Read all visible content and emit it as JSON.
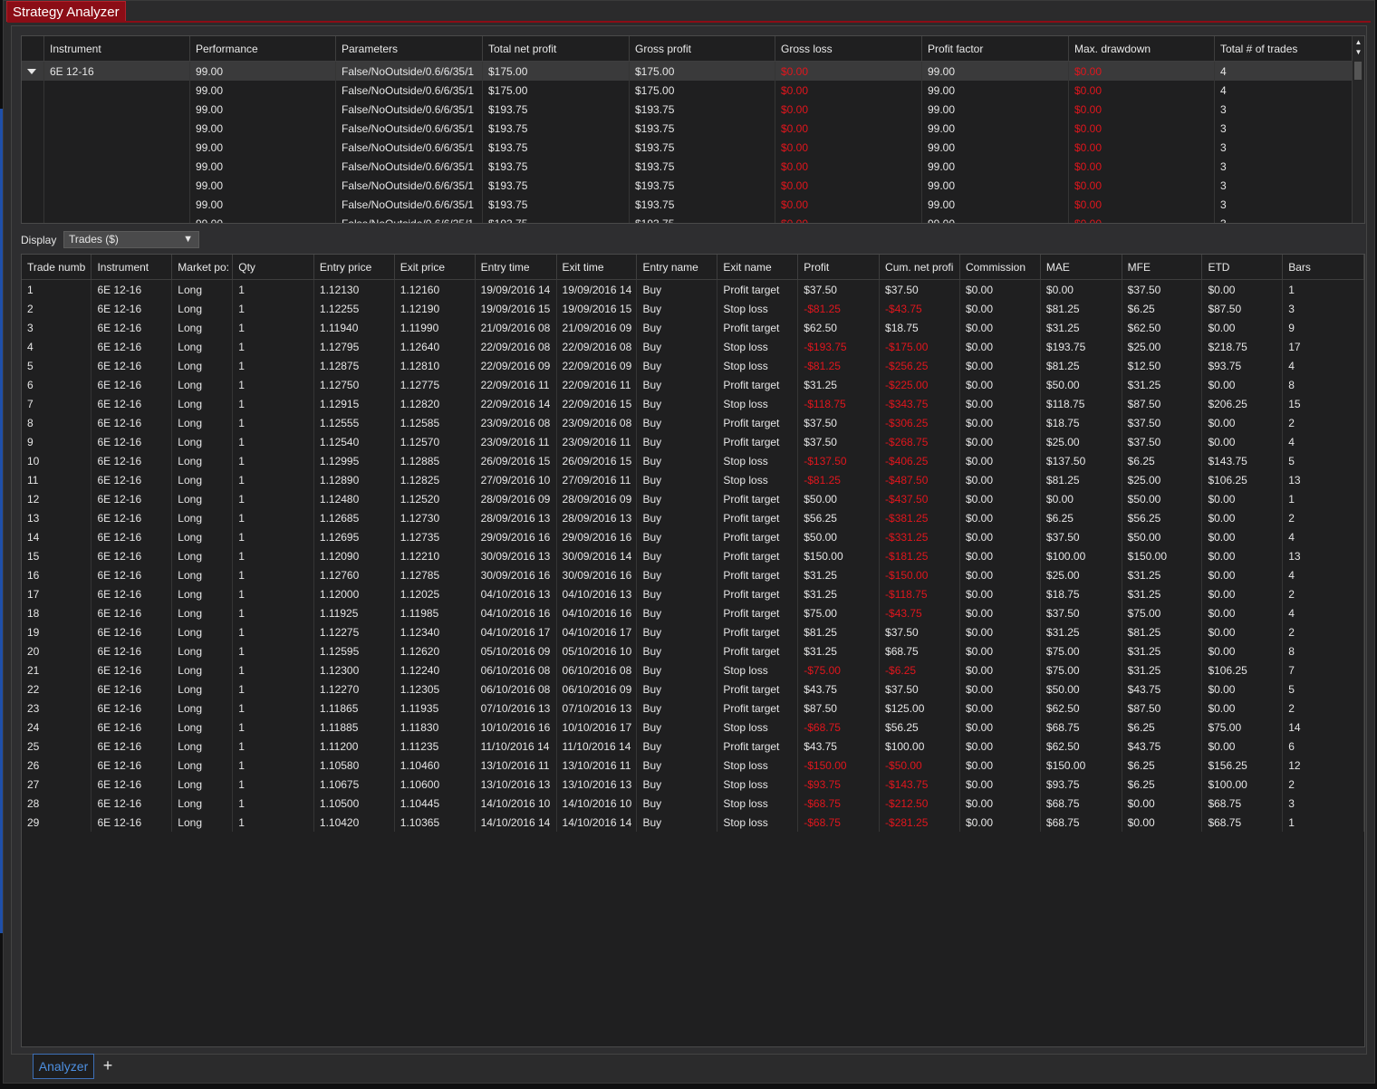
{
  "window": {
    "title": "Strategy Analyzer"
  },
  "optimizer": {
    "columns": [
      "Instrument",
      "Performance",
      "Parameters",
      "Total net profit",
      "Gross profit",
      "Gross loss",
      "Profit factor",
      "Max. drawdown",
      "Total # of trades"
    ],
    "group_instrument": "6E 12-16",
    "rows": [
      [
        "99.00",
        "False/NoOutside/0.6/6/35/1",
        "$175.00",
        "$175.00",
        "$0.00",
        "99.00",
        "$0.00",
        "4"
      ],
      [
        "99.00",
        "False/NoOutside/0.6/6/35/1",
        "$175.00",
        "$175.00",
        "$0.00",
        "99.00",
        "$0.00",
        "4"
      ],
      [
        "99.00",
        "False/NoOutside/0.6/6/35/1",
        "$193.75",
        "$193.75",
        "$0.00",
        "99.00",
        "$0.00",
        "3"
      ],
      [
        "99.00",
        "False/NoOutside/0.6/6/35/1",
        "$193.75",
        "$193.75",
        "$0.00",
        "99.00",
        "$0.00",
        "3"
      ],
      [
        "99.00",
        "False/NoOutside/0.6/6/35/1",
        "$193.75",
        "$193.75",
        "$0.00",
        "99.00",
        "$0.00",
        "3"
      ],
      [
        "99.00",
        "False/NoOutside/0.6/6/35/1",
        "$193.75",
        "$193.75",
        "$0.00",
        "99.00",
        "$0.00",
        "3"
      ],
      [
        "99.00",
        "False/NoOutside/0.6/6/35/1",
        "$193.75",
        "$193.75",
        "$0.00",
        "99.00",
        "$0.00",
        "3"
      ],
      [
        "99.00",
        "False/NoOutside/0.6/6/35/1",
        "$193.75",
        "$193.75",
        "$0.00",
        "99.00",
        "$0.00",
        "3"
      ],
      [
        "99.00",
        "False/NoOutside/0.6/6/35/1",
        "$193.75",
        "$193.75",
        "$0.00",
        "99.00",
        "$0.00",
        "3"
      ]
    ]
  },
  "display": {
    "label": "Display",
    "selected": "Trades ($)"
  },
  "trades": {
    "columns": [
      "Trade numb",
      "Instrument",
      "Market po:",
      "Qty",
      "Entry price",
      "Exit price",
      "Entry time",
      "Exit time",
      "Entry name",
      "Exit name",
      "Profit",
      "Cum. net profi",
      "Commission",
      "MAE",
      "MFE",
      "ETD",
      "Bars"
    ],
    "rows": [
      [
        "1",
        "6E 12-16",
        "Long",
        "1",
        "1.12130",
        "1.12160",
        "19/09/2016 14",
        "19/09/2016 14",
        "Buy",
        "Profit target",
        "$37.50",
        "$37.50",
        "$0.00",
        "$0.00",
        "$37.50",
        "$0.00",
        "1"
      ],
      [
        "2",
        "6E 12-16",
        "Long",
        "1",
        "1.12255",
        "1.12190",
        "19/09/2016 15",
        "19/09/2016 15",
        "Buy",
        "Stop loss",
        "-$81.25",
        "-$43.75",
        "$0.00",
        "$81.25",
        "$6.25",
        "$87.50",
        "3"
      ],
      [
        "3",
        "6E 12-16",
        "Long",
        "1",
        "1.11940",
        "1.11990",
        "21/09/2016 08",
        "21/09/2016 09",
        "Buy",
        "Profit target",
        "$62.50",
        "$18.75",
        "$0.00",
        "$31.25",
        "$62.50",
        "$0.00",
        "9"
      ],
      [
        "4",
        "6E 12-16",
        "Long",
        "1",
        "1.12795",
        "1.12640",
        "22/09/2016 08",
        "22/09/2016 08",
        "Buy",
        "Stop loss",
        "-$193.75",
        "-$175.00",
        "$0.00",
        "$193.75",
        "$25.00",
        "$218.75",
        "17"
      ],
      [
        "5",
        "6E 12-16",
        "Long",
        "1",
        "1.12875",
        "1.12810",
        "22/09/2016 09",
        "22/09/2016 09",
        "Buy",
        "Stop loss",
        "-$81.25",
        "-$256.25",
        "$0.00",
        "$81.25",
        "$12.50",
        "$93.75",
        "4"
      ],
      [
        "6",
        "6E 12-16",
        "Long",
        "1",
        "1.12750",
        "1.12775",
        "22/09/2016 11",
        "22/09/2016 11",
        "Buy",
        "Profit target",
        "$31.25",
        "-$225.00",
        "$0.00",
        "$50.00",
        "$31.25",
        "$0.00",
        "8"
      ],
      [
        "7",
        "6E 12-16",
        "Long",
        "1",
        "1.12915",
        "1.12820",
        "22/09/2016 14",
        "22/09/2016 15",
        "Buy",
        "Stop loss",
        "-$118.75",
        "-$343.75",
        "$0.00",
        "$118.75",
        "$87.50",
        "$206.25",
        "15"
      ],
      [
        "8",
        "6E 12-16",
        "Long",
        "1",
        "1.12555",
        "1.12585",
        "23/09/2016 08",
        "23/09/2016 08",
        "Buy",
        "Profit target",
        "$37.50",
        "-$306.25",
        "$0.00",
        "$18.75",
        "$37.50",
        "$0.00",
        "2"
      ],
      [
        "9",
        "6E 12-16",
        "Long",
        "1",
        "1.12540",
        "1.12570",
        "23/09/2016 11",
        "23/09/2016 11",
        "Buy",
        "Profit target",
        "$37.50",
        "-$268.75",
        "$0.00",
        "$25.00",
        "$37.50",
        "$0.00",
        "4"
      ],
      [
        "10",
        "6E 12-16",
        "Long",
        "1",
        "1.12995",
        "1.12885",
        "26/09/2016 15",
        "26/09/2016 15",
        "Buy",
        "Stop loss",
        "-$137.50",
        "-$406.25",
        "$0.00",
        "$137.50",
        "$6.25",
        "$143.75",
        "5"
      ],
      [
        "11",
        "6E 12-16",
        "Long",
        "1",
        "1.12890",
        "1.12825",
        "27/09/2016 10",
        "27/09/2016 11",
        "Buy",
        "Stop loss",
        "-$81.25",
        "-$487.50",
        "$0.00",
        "$81.25",
        "$25.00",
        "$106.25",
        "13"
      ],
      [
        "12",
        "6E 12-16",
        "Long",
        "1",
        "1.12480",
        "1.12520",
        "28/09/2016 09",
        "28/09/2016 09",
        "Buy",
        "Profit target",
        "$50.00",
        "-$437.50",
        "$0.00",
        "$0.00",
        "$50.00",
        "$0.00",
        "1"
      ],
      [
        "13",
        "6E 12-16",
        "Long",
        "1",
        "1.12685",
        "1.12730",
        "28/09/2016 13",
        "28/09/2016 13",
        "Buy",
        "Profit target",
        "$56.25",
        "-$381.25",
        "$0.00",
        "$6.25",
        "$56.25",
        "$0.00",
        "2"
      ],
      [
        "14",
        "6E 12-16",
        "Long",
        "1",
        "1.12695",
        "1.12735",
        "29/09/2016 16",
        "29/09/2016 16",
        "Buy",
        "Profit target",
        "$50.00",
        "-$331.25",
        "$0.00",
        "$37.50",
        "$50.00",
        "$0.00",
        "4"
      ],
      [
        "15",
        "6E 12-16",
        "Long",
        "1",
        "1.12090",
        "1.12210",
        "30/09/2016 13",
        "30/09/2016 14",
        "Buy",
        "Profit target",
        "$150.00",
        "-$181.25",
        "$0.00",
        "$100.00",
        "$150.00",
        "$0.00",
        "13"
      ],
      [
        "16",
        "6E 12-16",
        "Long",
        "1",
        "1.12760",
        "1.12785",
        "30/09/2016 16",
        "30/09/2016 16",
        "Buy",
        "Profit target",
        "$31.25",
        "-$150.00",
        "$0.00",
        "$25.00",
        "$31.25",
        "$0.00",
        "4"
      ],
      [
        "17",
        "6E 12-16",
        "Long",
        "1",
        "1.12000",
        "1.12025",
        "04/10/2016 13",
        "04/10/2016 13",
        "Buy",
        "Profit target",
        "$31.25",
        "-$118.75",
        "$0.00",
        "$18.75",
        "$31.25",
        "$0.00",
        "2"
      ],
      [
        "18",
        "6E 12-16",
        "Long",
        "1",
        "1.11925",
        "1.11985",
        "04/10/2016 16",
        "04/10/2016 16",
        "Buy",
        "Profit target",
        "$75.00",
        "-$43.75",
        "$0.00",
        "$37.50",
        "$75.00",
        "$0.00",
        "4"
      ],
      [
        "19",
        "6E 12-16",
        "Long",
        "1",
        "1.12275",
        "1.12340",
        "04/10/2016 17",
        "04/10/2016 17",
        "Buy",
        "Profit target",
        "$81.25",
        "$37.50",
        "$0.00",
        "$31.25",
        "$81.25",
        "$0.00",
        "2"
      ],
      [
        "20",
        "6E 12-16",
        "Long",
        "1",
        "1.12595",
        "1.12620",
        "05/10/2016 09",
        "05/10/2016 10",
        "Buy",
        "Profit target",
        "$31.25",
        "$68.75",
        "$0.00",
        "$75.00",
        "$31.25",
        "$0.00",
        "8"
      ],
      [
        "21",
        "6E 12-16",
        "Long",
        "1",
        "1.12300",
        "1.12240",
        "06/10/2016 08",
        "06/10/2016 08",
        "Buy",
        "Stop loss",
        "-$75.00",
        "-$6.25",
        "$0.00",
        "$75.00",
        "$31.25",
        "$106.25",
        "7"
      ],
      [
        "22",
        "6E 12-16",
        "Long",
        "1",
        "1.12270",
        "1.12305",
        "06/10/2016 08",
        "06/10/2016 09",
        "Buy",
        "Profit target",
        "$43.75",
        "$37.50",
        "$0.00",
        "$50.00",
        "$43.75",
        "$0.00",
        "5"
      ],
      [
        "23",
        "6E 12-16",
        "Long",
        "1",
        "1.11865",
        "1.11935",
        "07/10/2016 13",
        "07/10/2016 13",
        "Buy",
        "Profit target",
        "$87.50",
        "$125.00",
        "$0.00",
        "$62.50",
        "$87.50",
        "$0.00",
        "2"
      ],
      [
        "24",
        "6E 12-16",
        "Long",
        "1",
        "1.11885",
        "1.11830",
        "10/10/2016 16",
        "10/10/2016 17",
        "Buy",
        "Stop loss",
        "-$68.75",
        "$56.25",
        "$0.00",
        "$68.75",
        "$6.25",
        "$75.00",
        "14"
      ],
      [
        "25",
        "6E 12-16",
        "Long",
        "1",
        "1.11200",
        "1.11235",
        "11/10/2016 14",
        "11/10/2016 14",
        "Buy",
        "Profit target",
        "$43.75",
        "$100.00",
        "$0.00",
        "$62.50",
        "$43.75",
        "$0.00",
        "6"
      ],
      [
        "26",
        "6E 12-16",
        "Long",
        "1",
        "1.10580",
        "1.10460",
        "13/10/2016 11",
        "13/10/2016 11",
        "Buy",
        "Stop loss",
        "-$150.00",
        "-$50.00",
        "$0.00",
        "$150.00",
        "$6.25",
        "$156.25",
        "12"
      ],
      [
        "27",
        "6E 12-16",
        "Long",
        "1",
        "1.10675",
        "1.10600",
        "13/10/2016 13",
        "13/10/2016 13",
        "Buy",
        "Stop loss",
        "-$93.75",
        "-$143.75",
        "$0.00",
        "$93.75",
        "$6.25",
        "$100.00",
        "2"
      ],
      [
        "28",
        "6E 12-16",
        "Long",
        "1",
        "1.10500",
        "1.10445",
        "14/10/2016 10",
        "14/10/2016 10",
        "Buy",
        "Stop loss",
        "-$68.75",
        "-$212.50",
        "$0.00",
        "$68.75",
        "$0.00",
        "$68.75",
        "3"
      ],
      [
        "29",
        "6E 12-16",
        "Long",
        "1",
        "1.10420",
        "1.10365",
        "14/10/2016 14",
        "14/10/2016 14",
        "Buy",
        "Stop loss",
        "-$68.75",
        "-$281.25",
        "$0.00",
        "$68.75",
        "$0.00",
        "$68.75",
        "1"
      ]
    ]
  },
  "bottom_tabs": {
    "active": "Analyzer",
    "add_glyph": "+"
  },
  "colors": {
    "negative": "#e0161d",
    "title_bg": "#8b0d16",
    "active_tab": "#4d8fe0"
  }
}
